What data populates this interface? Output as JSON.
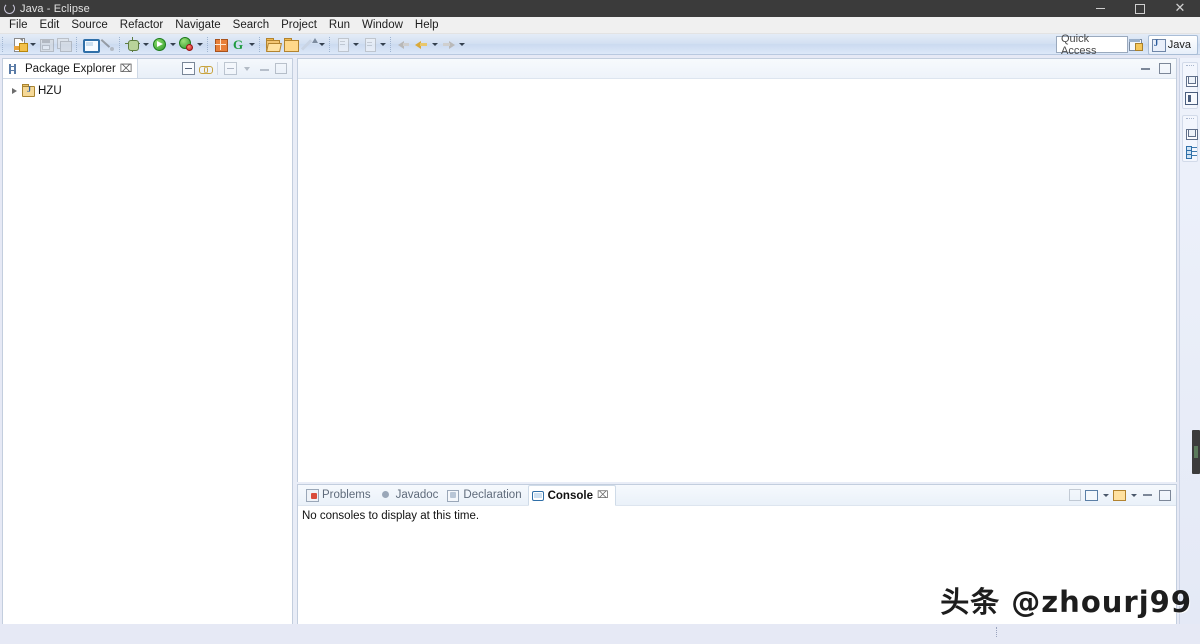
{
  "window": {
    "title": "Java - Eclipse",
    "app_icon": "eclipse-icon",
    "controls": {
      "minimize": "minimize-icon",
      "maximize": "maximize-icon",
      "close": "close-icon"
    }
  },
  "menubar": {
    "items": [
      {
        "label": "File"
      },
      {
        "label": "Edit"
      },
      {
        "label": "Source"
      },
      {
        "label": "Refactor"
      },
      {
        "label": "Navigate"
      },
      {
        "label": "Search"
      },
      {
        "label": "Project"
      },
      {
        "label": "Run"
      },
      {
        "label": "Window"
      },
      {
        "label": "Help"
      }
    ]
  },
  "toolbar": {
    "buttons": [
      {
        "name": "new-wizard-button",
        "icon": "new-file-icon",
        "has_dropdown": true,
        "enabled": true
      },
      {
        "name": "save-button",
        "icon": "save-icon",
        "has_dropdown": false,
        "enabled": false
      },
      {
        "name": "save-all-button",
        "icon": "save-all-icon",
        "has_dropdown": false,
        "enabled": false
      },
      {
        "name": "new-console-view-button",
        "icon": "console-icon",
        "has_dropdown": false,
        "enabled": true
      },
      {
        "name": "toggle-mark-occurrences-button",
        "icon": "wand-icon",
        "has_dropdown": false,
        "enabled": false
      },
      {
        "name": "debug-button",
        "icon": "debug-bug-icon",
        "has_dropdown": true,
        "enabled": true
      },
      {
        "name": "run-button",
        "icon": "run-green-play-icon",
        "has_dropdown": true,
        "enabled": true
      },
      {
        "name": "run-coverage-button",
        "icon": "coverage-icon",
        "has_dropdown": true,
        "enabled": true
      },
      {
        "name": "new-java-project-button",
        "icon": "java-project-icon",
        "has_dropdown": false,
        "enabled": true
      },
      {
        "name": "new-java-class-button",
        "icon": "green-g-icon",
        "has_dropdown": true,
        "enabled": true
      },
      {
        "name": "open-type-button",
        "icon": "open-folder-icon",
        "has_dropdown": false,
        "enabled": true
      },
      {
        "name": "open-task-button",
        "icon": "folder-icon",
        "has_dropdown": false,
        "enabled": true
      },
      {
        "name": "edit-button",
        "icon": "pencil-icon",
        "has_dropdown": true,
        "enabled": true
      },
      {
        "name": "next-annotation-button",
        "icon": "next-annotation-icon",
        "has_dropdown": true,
        "enabled": false
      },
      {
        "name": "previous-annotation-button",
        "icon": "previous-annotation-icon",
        "has_dropdown": true,
        "enabled": false
      },
      {
        "name": "back-button",
        "icon": "back-arrow-icon",
        "has_dropdown": false,
        "enabled": false
      },
      {
        "name": "backward-history-button",
        "icon": "backward-history-arrow-icon",
        "has_dropdown": true,
        "enabled": true
      },
      {
        "name": "forward-history-button",
        "icon": "forward-history-arrow-icon",
        "has_dropdown": true,
        "enabled": false
      }
    ]
  },
  "quick_access": {
    "placeholder": "Quick Access",
    "value": ""
  },
  "perspective": {
    "open_perspective_tooltip": "open-perspective-icon",
    "active_label": "Java",
    "active_icon": "java-perspective-icon"
  },
  "package_explorer": {
    "tab_label": "Package Explorer",
    "tab_icon": "package-explorer-icon",
    "close_glyph": "⌧",
    "tools": [
      {
        "name": "collapse-all-button",
        "icon": "collapse-all-icon",
        "enabled": true
      },
      {
        "name": "link-with-editor-button",
        "icon": "link-editor-icon",
        "enabled": true
      },
      {
        "name": "focus-on-active-task-button",
        "icon": "focus-task-icon",
        "enabled": false
      },
      {
        "name": "view-menu-button",
        "icon": "view-menu-icon",
        "enabled": true
      },
      {
        "name": "minimize-view-button",
        "icon": "minimize-icon",
        "enabled": true
      },
      {
        "name": "maximize-view-button",
        "icon": "maximize-icon",
        "enabled": true
      }
    ],
    "tree": [
      {
        "label": "HZU",
        "icon": "java-project-folder-icon",
        "expanded": false,
        "expander": "chevron-right-icon"
      }
    ]
  },
  "editor_area": {
    "tabs": [],
    "tools": [
      {
        "name": "minimize-editor-button",
        "icon": "minimize-icon"
      },
      {
        "name": "maximize-editor-button",
        "icon": "maximize-icon"
      }
    ]
  },
  "bottom_panel": {
    "tabs": [
      {
        "label": "Problems",
        "icon": "problems-icon",
        "active": false
      },
      {
        "label": "Javadoc",
        "icon": "javadoc-icon",
        "active": false
      },
      {
        "label": "Declaration",
        "icon": "declaration-icon",
        "active": false
      },
      {
        "label": "Console",
        "icon": "console-icon",
        "active": true,
        "close_glyph": "⌧"
      }
    ],
    "tools": [
      {
        "name": "pin-console-button",
        "icon": "pin-icon",
        "enabled": false,
        "has_dropdown": false
      },
      {
        "name": "display-selected-console-button",
        "icon": "display-console-icon",
        "enabled": true,
        "has_dropdown": true
      },
      {
        "name": "open-console-button",
        "icon": "open-console-icon",
        "enabled": true,
        "has_dropdown": true
      },
      {
        "name": "minimize-console-button",
        "icon": "minimize-icon",
        "enabled": true,
        "has_dropdown": false
      },
      {
        "name": "maximize-console-button",
        "icon": "maximize-icon",
        "enabled": true,
        "has_dropdown": false
      }
    ],
    "content": {
      "message": "No consoles to display at this time."
    }
  },
  "fast_view_bar": {
    "groups": [
      {
        "buttons": [
          {
            "name": "restore-button",
            "icon": "restore-icon"
          },
          {
            "name": "package-explorer-fastview-button",
            "icon": "package-explorer-icon"
          }
        ]
      },
      {
        "buttons": [
          {
            "name": "restore-editor-button",
            "icon": "restore-icon"
          },
          {
            "name": "outline-fastview-button",
            "icon": "outline-icon"
          }
        ]
      }
    ]
  },
  "watermark": {
    "text": "头条 @zhourj99"
  },
  "colors": {
    "titlebar_bg": "#3b3b3b",
    "menubar_bg": "#f0f0f0",
    "toolbar_bg": "#d3e0f2",
    "panel_bg": "#ffffff",
    "chrome_bg": "#e6e9f5",
    "border": "#c3cede",
    "accent_green": "#2e9b29",
    "accent_orange": "#e8803a"
  }
}
